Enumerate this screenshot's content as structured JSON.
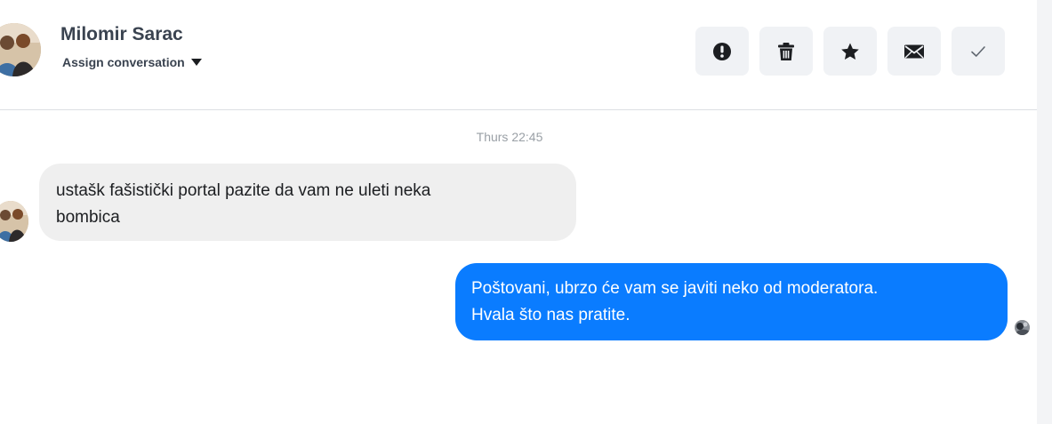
{
  "header": {
    "contact_name": "Milomir Sarac",
    "assign_label": "Assign conversation",
    "actions": [
      {
        "icon": "alert-circle-icon"
      },
      {
        "icon": "trash-icon"
      },
      {
        "icon": "star-icon"
      },
      {
        "icon": "envelope-icon"
      },
      {
        "icon": "checkmark-icon"
      }
    ]
  },
  "conversation": {
    "timestamp": "Thurs 22:45",
    "messages": [
      {
        "direction": "incoming",
        "lines": [
          "ustašk fašistički portal pazite da vam ne uleti neka",
          "bombica"
        ]
      },
      {
        "direction": "outgoing",
        "lines": [
          "Poštovani, ubrzo će vam se javiti neko od moderatora.",
          "Hvala što nas pratite."
        ]
      }
    ]
  },
  "colors": {
    "outgoing_bubble": "#0a7cff",
    "incoming_bubble": "#efefef",
    "action_button_bg": "#f0f2f5"
  }
}
